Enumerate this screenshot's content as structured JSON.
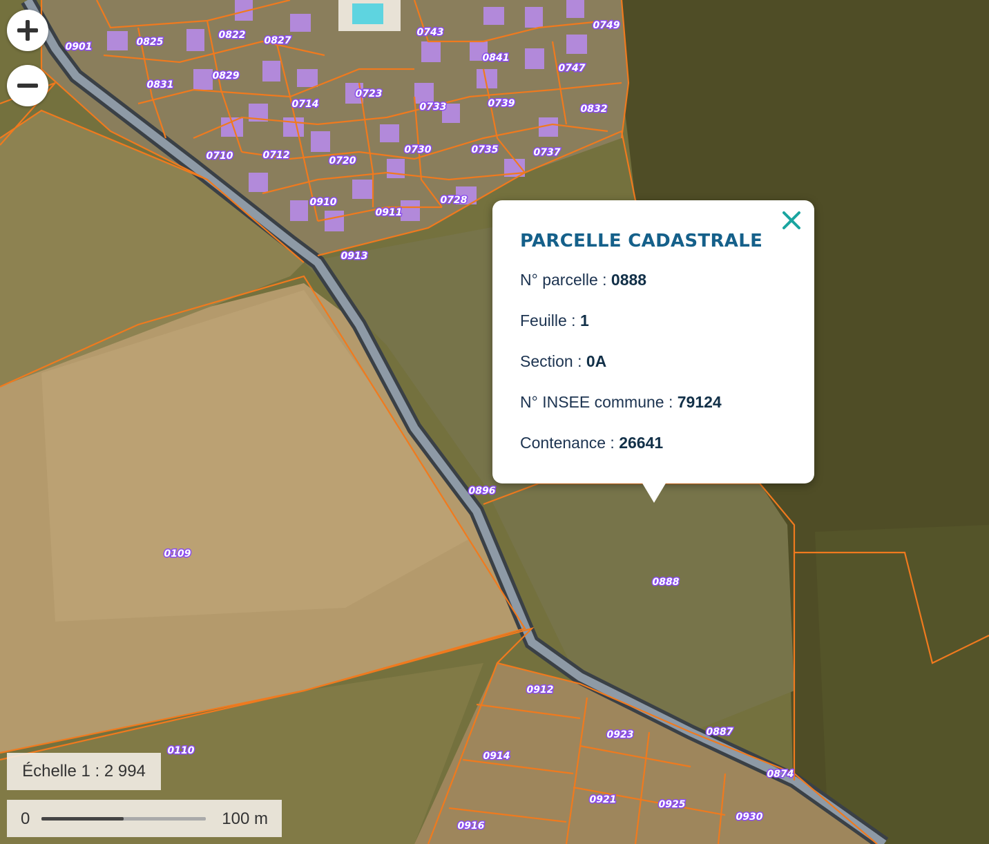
{
  "map": {
    "parcels": [
      {
        "label": "0901"
      },
      {
        "label": "0825"
      },
      {
        "label": "0822"
      },
      {
        "label": "0827"
      },
      {
        "label": "0831"
      },
      {
        "label": "0829"
      },
      {
        "label": "0714"
      },
      {
        "label": "0743"
      },
      {
        "label": "0841"
      },
      {
        "label": "0749"
      },
      {
        "label": "0747"
      },
      {
        "label": "0723"
      },
      {
        "label": "0733"
      },
      {
        "label": "0739"
      },
      {
        "label": "0832"
      },
      {
        "label": "0710"
      },
      {
        "label": "0712"
      },
      {
        "label": "0720"
      },
      {
        "label": "0730"
      },
      {
        "label": "0735"
      },
      {
        "label": "0737"
      },
      {
        "label": "0910"
      },
      {
        "label": "0911"
      },
      {
        "label": "0728"
      },
      {
        "label": "0913"
      },
      {
        "label": "0896"
      },
      {
        "label": "0109"
      },
      {
        "label": "0888"
      },
      {
        "label": "0912"
      },
      {
        "label": "0923"
      },
      {
        "label": "0887"
      },
      {
        "label": "0110"
      },
      {
        "label": "0914"
      },
      {
        "label": "0874"
      },
      {
        "label": "0921"
      },
      {
        "label": "0925"
      },
      {
        "label": "0930"
      },
      {
        "label": "0916"
      }
    ]
  },
  "controls": {
    "zoom_in": "zoom-in",
    "zoom_out": "zoom-out"
  },
  "scale": {
    "text": "Échelle 1 :  2 994",
    "bar_start": "0",
    "bar_end": "100 m"
  },
  "popup": {
    "title": "PARCELLE CADASTRALE",
    "fields": [
      {
        "label": "N° parcelle : ",
        "value": "0888"
      },
      {
        "label": "Feuille : ",
        "value": "1"
      },
      {
        "label": "Section : ",
        "value": "0A"
      },
      {
        "label": "N° INSEE commune : ",
        "value": "79124"
      },
      {
        "label": "Contenance : ",
        "value": "26641"
      }
    ]
  },
  "colors": {
    "parcel_border": "#f07a1e",
    "label_outline": "#8a4cf0",
    "popup_title": "#15608a",
    "close_icon": "#1aa5a0"
  }
}
